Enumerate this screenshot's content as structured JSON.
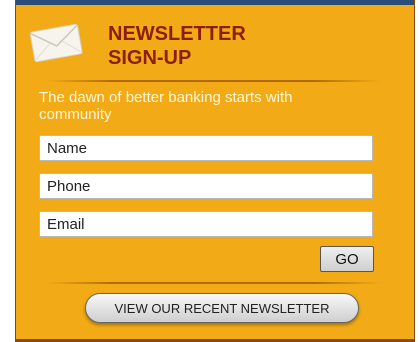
{
  "newsletter": {
    "title_line1": "NEWSLETTER",
    "title_line2": "SIGN-UP",
    "icon": "envelope-icon",
    "tagline": "The dawn of better banking starts with community",
    "fields": {
      "name_placeholder": "Name",
      "phone_placeholder": "Phone",
      "email_placeholder": "Email"
    },
    "go_label": "GO",
    "recent_label": "VIEW OUR RECENT NEWSLETTER"
  },
  "colors": {
    "panel_background": "#f2ab17",
    "title": "#8a1f12",
    "tagline": "#fff6d8",
    "top_bar": "#2a4d7a"
  }
}
